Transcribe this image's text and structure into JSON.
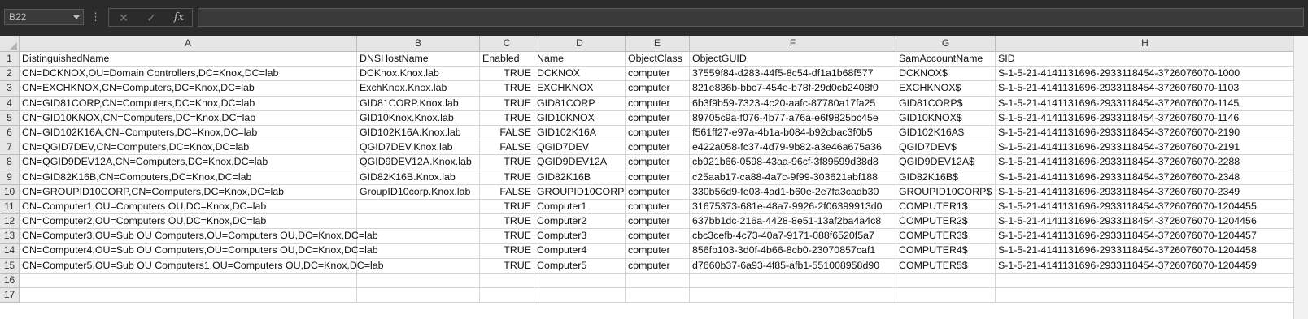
{
  "formula_bar": {
    "name_box": "B22",
    "more_glyph": "⋮",
    "cancel_glyph": "✕",
    "enter_glyph": "✓",
    "fx_glyph": "fx",
    "formula_value": ""
  },
  "sheet": {
    "columns": [
      "A",
      "B",
      "C",
      "D",
      "E",
      "F",
      "G",
      "H"
    ],
    "row_numbers": [
      "1",
      "2",
      "3",
      "4",
      "5",
      "6",
      "7",
      "8",
      "9",
      "10",
      "11",
      "12",
      "13",
      "14",
      "15",
      "16",
      "17"
    ],
    "rows": [
      [
        "DistinguishedName",
        "DNSHostName",
        "Enabled",
        "Name",
        "ObjectClass",
        "ObjectGUID",
        "SamAccountName",
        "SID"
      ],
      [
        "CN=DCKNOX,OU=Domain Controllers,DC=Knox,DC=lab",
        "DCKnox.Knox.lab",
        "TRUE",
        "DCKNOX",
        "computer",
        "37559f84-d283-44f5-8c54-df1a1b68f577",
        "DCKNOX$",
        "S-1-5-21-4141131696-2933118454-3726076070-1000"
      ],
      [
        "CN=EXCHKNOX,CN=Computers,DC=Knox,DC=lab",
        "ExchKnox.Knox.lab",
        "TRUE",
        "EXCHKNOX",
        "computer",
        "821e836b-bbc7-454e-b78f-29d0cb2408f0",
        "EXCHKNOX$",
        "S-1-5-21-4141131696-2933118454-3726076070-1103"
      ],
      [
        "CN=GID81CORP,CN=Computers,DC=Knox,DC=lab",
        "GID81CORP.Knox.lab",
        "TRUE",
        "GID81CORP",
        "computer",
        "6b3f9b59-7323-4c20-aafc-87780a17fa25",
        "GID81CORP$",
        "S-1-5-21-4141131696-2933118454-3726076070-1145"
      ],
      [
        "CN=GID10KNOX,CN=Computers,DC=Knox,DC=lab",
        "GID10Knox.Knox.lab",
        "TRUE",
        "GID10KNOX",
        "computer",
        "89705c9a-f076-4b77-a76a-e6f9825bc45e",
        "GID10KNOX$",
        "S-1-5-21-4141131696-2933118454-3726076070-1146"
      ],
      [
        "CN=GID102K16A,CN=Computers,DC=Knox,DC=lab",
        "GID102K16A.Knox.lab",
        "FALSE",
        "GID102K16A",
        "computer",
        "f561ff27-e97a-4b1a-b084-b92cbac3f0b5",
        "GID102K16A$",
        "S-1-5-21-4141131696-2933118454-3726076070-2190"
      ],
      [
        "CN=QGID7DEV,CN=Computers,DC=Knox,DC=lab",
        "QGID7DEV.Knox.lab",
        "FALSE",
        "QGID7DEV",
        "computer",
        "e422a058-fc37-4d79-9b82-a3e46a675a36",
        "QGID7DEV$",
        "S-1-5-21-4141131696-2933118454-3726076070-2191"
      ],
      [
        "CN=QGID9DEV12A,CN=Computers,DC=Knox,DC=lab",
        "QGID9DEV12A.Knox.lab",
        "TRUE",
        "QGID9DEV12A",
        "computer",
        "cb921b66-0598-43aa-96cf-3f89599d38d8",
        "QGID9DEV12A$",
        "S-1-5-21-4141131696-2933118454-3726076070-2288"
      ],
      [
        "CN=GID82K16B,CN=Computers,DC=Knox,DC=lab",
        "GID82K16B.Knox.lab",
        "TRUE",
        "GID82K16B",
        "computer",
        "c25aab17-ca88-4a7c-9f99-303621abf188",
        "GID82K16B$",
        "S-1-5-21-4141131696-2933118454-3726076070-2348"
      ],
      [
        "CN=GROUPID10CORP,CN=Computers,DC=Knox,DC=lab",
        "GroupID10corp.Knox.lab",
        "FALSE",
        "GROUPID10CORP",
        "computer",
        "330b56d9-fe03-4ad1-b60e-2e7fa3cadb30",
        "GROUPID10CORP$",
        "S-1-5-21-4141131696-2933118454-3726076070-2349"
      ],
      [
        "CN=Computer1,OU=Computers OU,DC=Knox,DC=lab",
        "",
        "TRUE",
        "Computer1",
        "computer",
        "31675373-681e-48a7-9926-2f06399913d0",
        "COMPUTER1$",
        "S-1-5-21-4141131696-2933118454-3726076070-1204455"
      ],
      [
        "CN=Computer2,OU=Computers OU,DC=Knox,DC=lab",
        "",
        "TRUE",
        "Computer2",
        "computer",
        "637bb1dc-216a-4428-8e51-13af2ba4a4c8",
        "COMPUTER2$",
        "S-1-5-21-4141131696-2933118454-3726076070-1204456"
      ],
      [
        "CN=Computer3,OU=Sub OU Computers,OU=Computers OU,DC=Knox,DC=lab",
        "",
        "TRUE",
        "Computer3",
        "computer",
        "cbc3cefb-4c73-40a7-9171-088f6520f5a7",
        "COMPUTER3$",
        "S-1-5-21-4141131696-2933118454-3726076070-1204457"
      ],
      [
        "CN=Computer4,OU=Sub OU Computers,OU=Computers OU,DC=Knox,DC=lab",
        "",
        "TRUE",
        "Computer4",
        "computer",
        "856fb103-3d0f-4b66-8cb0-23070857caf1",
        "COMPUTER4$",
        "S-1-5-21-4141131696-2933118454-3726076070-1204458"
      ],
      [
        "CN=Computer5,OU=Sub OU Computers1,OU=Computers OU,DC=Knox,DC=lab",
        "",
        "TRUE",
        "Computer5",
        "computer",
        "d7660b37-6a93-4f85-afb1-551008958d90",
        "COMPUTER5$",
        "S-1-5-21-4141131696-2933118454-3726076070-1204459"
      ],
      [
        "",
        "",
        "",
        "",
        "",
        "",
        "",
        ""
      ],
      [
        "",
        "",
        "",
        "",
        "",
        "",
        "",
        ""
      ]
    ]
  }
}
